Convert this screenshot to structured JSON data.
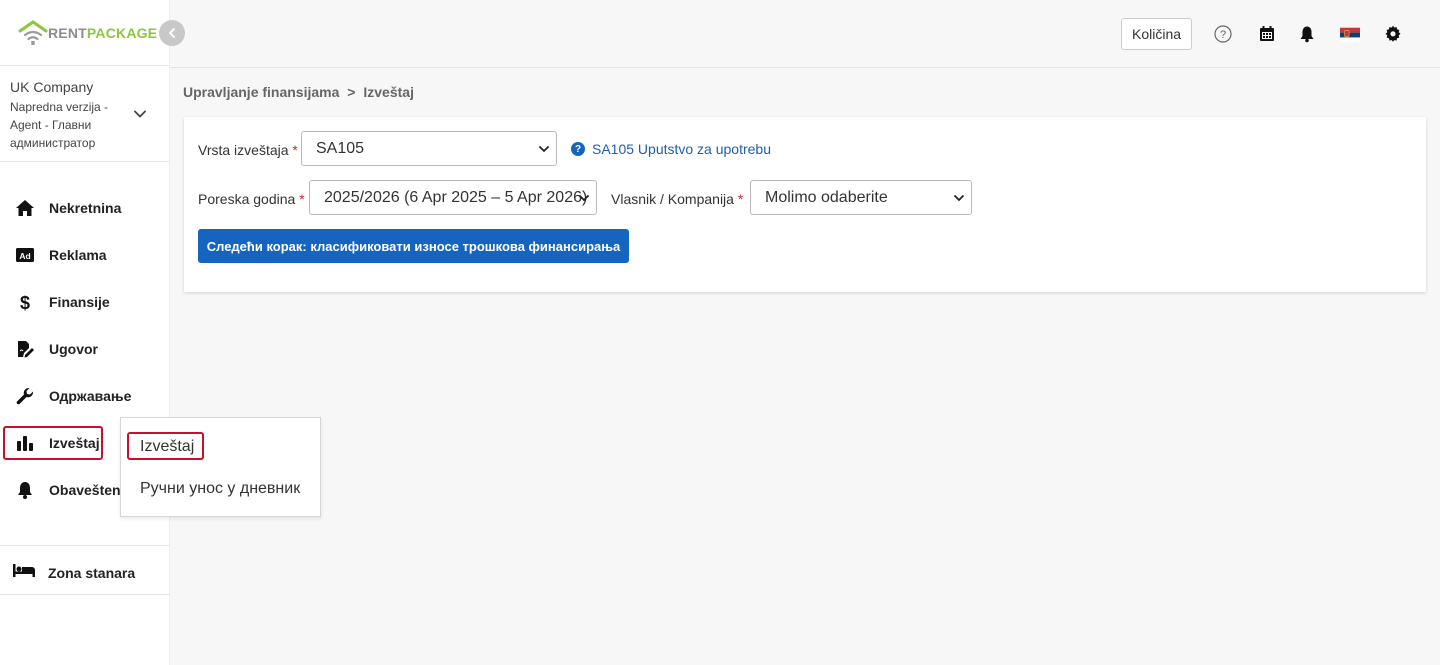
{
  "brand": {
    "rent": "RENT",
    "package": "PACKAGE"
  },
  "company": {
    "name": "UK Company",
    "role": "Napredna verzija - Agent - Главни администратор"
  },
  "sidebar": {
    "items": [
      {
        "label": "Nekretnina",
        "icon": "home-icon"
      },
      {
        "label": "Reklama",
        "icon": "ad-icon"
      },
      {
        "label": "Finansije",
        "icon": "dollar-icon"
      },
      {
        "label": "Ugovor",
        "icon": "contract-icon"
      },
      {
        "label": "Одржавање",
        "icon": "wrench-icon"
      },
      {
        "label": "Izveštaj",
        "icon": "chart-icon"
      },
      {
        "label": "Obaveštenja",
        "icon": "bell-icon"
      }
    ],
    "tenant_zone": {
      "label": "Zona stanara",
      "icon": "bed-icon"
    }
  },
  "submenu": {
    "items": [
      {
        "label": "Izveštaj"
      },
      {
        "label": "Ручни унос у дневник"
      }
    ]
  },
  "topbar": {
    "quantity_label": "Količina",
    "icons": [
      "help-icon",
      "calendar-icon",
      "bell-icon",
      "serbia-flag-icon",
      "gear-icon"
    ]
  },
  "breadcrumb": {
    "parent": "Upravljanje finansijama",
    "separator": ">",
    "current": "Izveštaj"
  },
  "form": {
    "report_type": {
      "label": "Vrsta izveštaja",
      "value": "SA105"
    },
    "help_link": "SA105 Uputstvo za upotrebu",
    "tax_year": {
      "label": "Poreska godina",
      "value": "2025/2026 (6 Apr 2025 – 5 Apr 2026)"
    },
    "owner": {
      "label": "Vlasnik / Kompanija",
      "value": "Molimo odaberite"
    },
    "required_mark": "*",
    "next_button": "Следећи корак: класификовати износе трошкова финансирања"
  },
  "colors": {
    "primary": "#1565c0",
    "highlight": "#c8102e",
    "brand_green": "#8cc63f"
  }
}
